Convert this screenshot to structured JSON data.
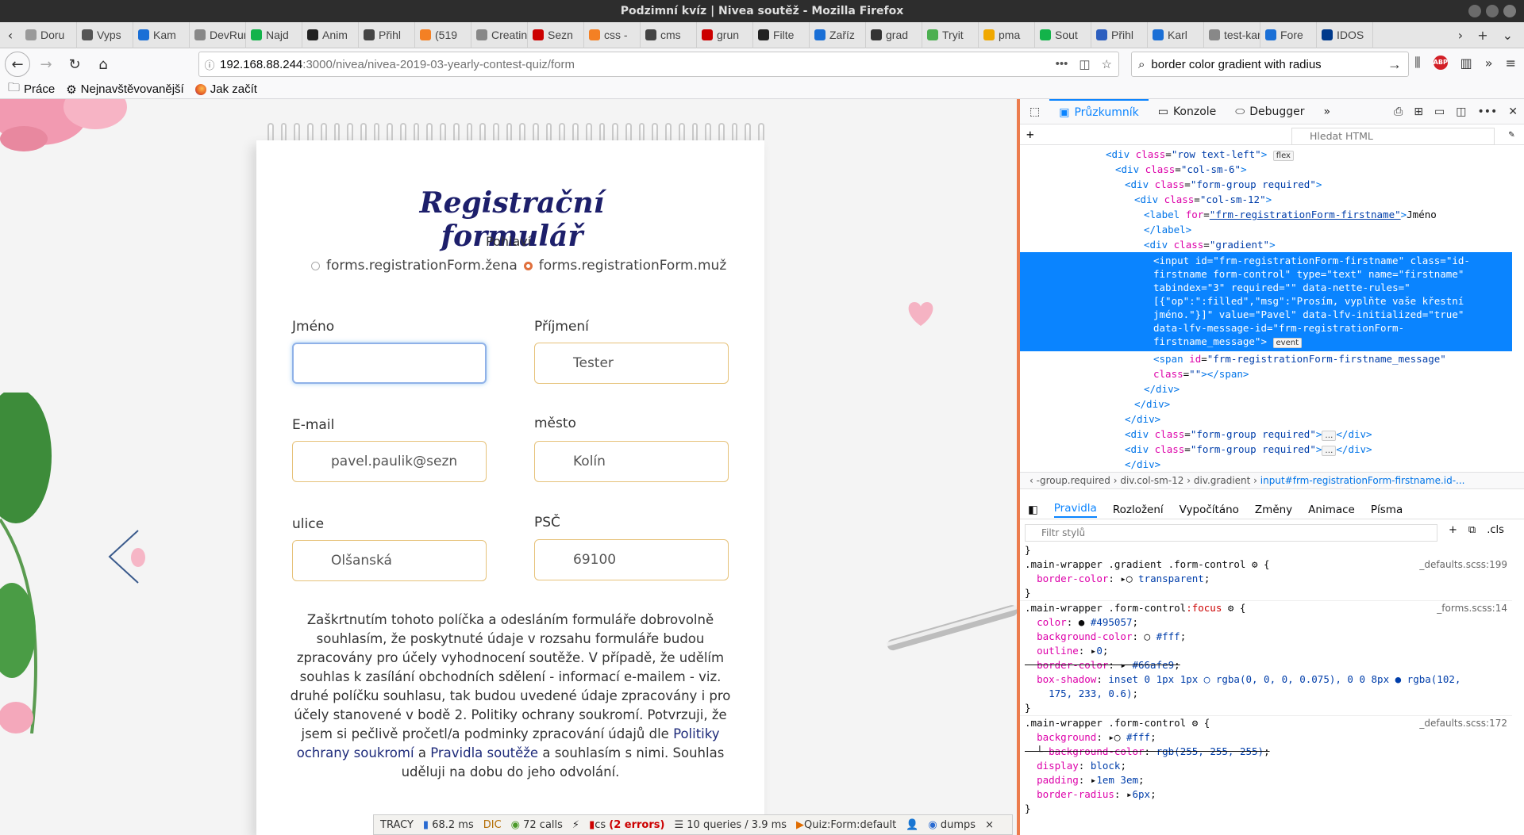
{
  "window": {
    "title": "Podzimní kvíz | Nivea soutěž - Mozilla Firefox"
  },
  "tabs": [
    {
      "label": "Doru",
      "color": "#9a9a9a"
    },
    {
      "label": "Vyps",
      "color": "#555"
    },
    {
      "label": "Kam",
      "color": "#1a6fd6"
    },
    {
      "label": "DevRun",
      "color": "#888"
    },
    {
      "label": "Najd",
      "color": "#13b34a"
    },
    {
      "label": "Anim",
      "color": "#222"
    },
    {
      "label": "Přihl",
      "color": "#444"
    },
    {
      "label": "(519",
      "color": "#f48024"
    },
    {
      "label": "Creatinc",
      "color": "#888"
    },
    {
      "label": "Sezn",
      "color": "#cc0000"
    },
    {
      "label": "css -",
      "color": "#f48024"
    },
    {
      "label": "cms",
      "color": "#444"
    },
    {
      "label": "grun",
      "color": "#c00"
    },
    {
      "label": "Filte",
      "color": "#222"
    },
    {
      "label": "Zaříz",
      "color": "#1a6fd6"
    },
    {
      "label": "grad",
      "color": "#333"
    },
    {
      "label": "Tryit",
      "color": "#4caf50"
    },
    {
      "label": "pma",
      "color": "#f0a800"
    },
    {
      "label": "Sout",
      "color": "#13b34a"
    },
    {
      "label": "Přihl",
      "color": "#2d5fbf"
    },
    {
      "label": "Karl",
      "color": "#1a6fd6"
    },
    {
      "label": "test-kar",
      "color": "#888"
    },
    {
      "label": "Fore",
      "color": "#1a6fd6"
    },
    {
      "label": "IDOS",
      "color": "#003a8c"
    }
  ],
  "nav": {
    "url_host": "192.168.88.244",
    "url_path": ":3000/nivea/nivea-2019-03-yearly-contest-quiz/form",
    "search_value": "border color gradient with radius"
  },
  "bookmarks": [
    {
      "label": "Práce",
      "icon": "folder-icon"
    },
    {
      "label": "Nejnavštěvovanější",
      "icon": "gear-icon"
    },
    {
      "label": "Jak začít",
      "icon": "firefox-icon"
    }
  ],
  "form": {
    "title": "Registrační formulář",
    "gender_label": "Pohlaví",
    "gender_options": [
      "forms.registrationForm.žena",
      "forms.registrationForm.muž"
    ],
    "fields": {
      "firstname": {
        "label": "Jméno",
        "value": ""
      },
      "lastname": {
        "label": "Příjmení",
        "value": "Tester"
      },
      "email": {
        "label": "E-mail",
        "value": "pavel.paulik@sezn"
      },
      "city": {
        "label": "město",
        "value": "Kolín"
      },
      "street": {
        "label": "ulice",
        "value": "Olšanská"
      },
      "zip": {
        "label": "PSČ",
        "value": "69100"
      }
    },
    "consent_text": "Zaškrtnutím tohoto políčka a odesláním formuláře dobrovolně souhlasím, že poskytnuté údaje v rozsahu formuláře budou zpracovány pro účely vyhodnocení soutěže. V případě, že udělím souhlas k zasílání obchodních sdělení - informací e-mailem - viz. druhé políčku souhlasu, tak budou uvedené údaje zpracovány i pro účely stanovené v bodě 2. Politiky ochrany soukromí. Potvrzuji, že jsem si pečlivě pročetl/a podminky zpracování údajů dle",
    "consent_link1": "Politiky ochrany soukromí",
    "consent_mid": "a",
    "consent_link2": "Pravidla soutěže",
    "consent_end": "a souhlasím s nimi. Souhlas uděluji na dobu do jeho odvolání."
  },
  "tracy": {
    "label": "TRACY",
    "time": "68.2 ms",
    "calls": "72 calls",
    "lang": "cs",
    "errors": "(2 errors)",
    "queries": "10 queries / 3.9 ms",
    "route": "Quiz:Form:default",
    "dumps": "dumps"
  },
  "devtools": {
    "tabs": [
      "Průzkumník",
      "Konzole",
      "Debugger"
    ],
    "search_placeholder": "Hledat HTML",
    "breadcrumb": [
      "-group.required",
      "div.col-sm-12",
      "div.gradient",
      "input#frm-registrationForm-firstname.id-..."
    ],
    "subtabs": [
      "Pravidla",
      "Rozložení",
      "Vypočítáno",
      "Změny",
      "Animace",
      "Písma"
    ],
    "filter_placeholder": "Filtr stylů",
    "cls": ".cls"
  },
  "accent": "#0a84ff"
}
